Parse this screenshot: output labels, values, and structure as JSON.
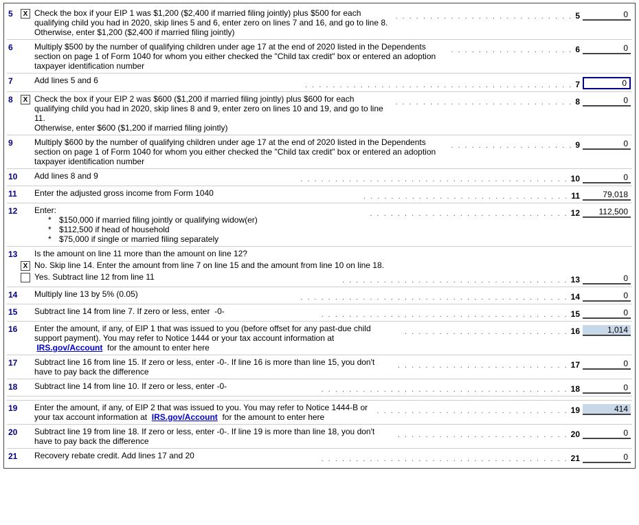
{
  "form": {
    "rows": [
      {
        "id": "row5",
        "lineNum": "5",
        "hasCheckbox": true,
        "checkboxChecked": true,
        "content": "Check the box if your EIP 1 was $1,200 ($2,400 if married filing jointly) plus $500 for each qualifying child you had in 2020, skip lines 5 and 6, enter zero on lines 7 and 16, and go to line 8. Otherwise, enter $1,200 ($2,400 if married filing jointly)",
        "hasDots": true,
        "lineRef": "5",
        "value": "0",
        "highlighted": false,
        "activeBorder": false
      },
      {
        "id": "row6",
        "lineNum": "6",
        "hasCheckbox": false,
        "content": "Multiply $500 by the number of qualifying children under age 17 at the end of 2020 listed in the Dependents section on page 1 of Form 1040 for whom you either checked the \"Child tax credit\" box or entered an adoption taxpayer identification number",
        "hasDots": true,
        "lineRef": "6",
        "value": "0",
        "highlighted": false,
        "activeBorder": false
      },
      {
        "id": "row7",
        "lineNum": "7",
        "hasCheckbox": false,
        "content": "Add lines 5 and 6",
        "hasDots": true,
        "lineRef": "7",
        "value": "0",
        "highlighted": false,
        "activeBorder": true
      },
      {
        "id": "row8",
        "lineNum": "8",
        "hasCheckbox": true,
        "checkboxChecked": true,
        "content": "Check the box if your EIP 2 was $600 ($1,200 if married filing jointly) plus $600 for each qualifying child you had in 2020, skip lines 8 and 9, enter zero on lines 10 and 19, and go to line 11. Otherwise, enter $600 ($1,200 if married filing jointly)",
        "hasDots": true,
        "lineRef": "8",
        "value": "0",
        "highlighted": false,
        "activeBorder": false
      },
      {
        "id": "row9",
        "lineNum": "9",
        "hasCheckbox": false,
        "content": "Multiply $600 by the number of qualifying children under age 17 at the end of 2020 listed in the Dependents section on page 1 of Form 1040 for whom you either checked the \"Child tax credit\" box or entered an adoption taxpayer identification number",
        "hasDots": true,
        "lineRef": "9",
        "value": "0",
        "highlighted": false,
        "activeBorder": false
      },
      {
        "id": "row10",
        "lineNum": "10",
        "hasCheckbox": false,
        "content": "Add lines 8 and 9",
        "hasDots": true,
        "lineRef": "10",
        "value": "0",
        "highlighted": false,
        "activeBorder": false
      },
      {
        "id": "row11",
        "lineNum": "11",
        "hasCheckbox": false,
        "content": "Enter the adjusted gross income from Form 1040",
        "hasDots": true,
        "lineRef": "11",
        "value": "79,018",
        "highlighted": false,
        "activeBorder": false
      },
      {
        "id": "row12",
        "lineNum": "12",
        "hasCheckbox": false,
        "content": "Enter:",
        "bullets": [
          "$150,000 if married filing jointly or qualifying widow(er)",
          "$112,500 if head of household",
          "$75,000 if single or married filing separately"
        ],
        "hasDots": true,
        "lineRef": "12",
        "value": "112,500",
        "highlighted": false,
        "activeBorder": false
      },
      {
        "id": "row13label",
        "lineNum": "13",
        "hasCheckbox": false,
        "content": "Is the amount on line 11 more than the amount on line 12?",
        "hasDots": false,
        "lineRef": "",
        "value": "",
        "highlighted": false,
        "activeBorder": false
      },
      {
        "id": "row13a",
        "isSubRow": true,
        "hasCheckbox": true,
        "checkboxChecked": true,
        "subContent": "No. Skip line 14. Enter the amount from line 7 on line 15 and the amount from line 10 on line 18.",
        "hasDots": false,
        "lineRef": "",
        "value": "",
        "highlighted": false,
        "activeBorder": false
      },
      {
        "id": "row13b",
        "isSubRow": true,
        "hasCheckbox": true,
        "checkboxChecked": false,
        "subContent": "Yes. Subtract line 12 from line 11",
        "hasDots": true,
        "lineRef": "13",
        "value": "0",
        "highlighted": false,
        "activeBorder": false
      },
      {
        "id": "row14",
        "lineNum": "14",
        "hasCheckbox": false,
        "content": "Multiply line 13 by 5% (0.05)",
        "hasDots": true,
        "lineRef": "14",
        "value": "0",
        "highlighted": false,
        "activeBorder": false
      },
      {
        "id": "row15",
        "lineNum": "15",
        "hasCheckbox": false,
        "content": "Subtract line 14 from line 7. If zero or less, enter  -0-",
        "hasDots": true,
        "lineRef": "15",
        "value": "0",
        "highlighted": false,
        "activeBorder": false
      },
      {
        "id": "row16",
        "lineNum": "16",
        "hasCheckbox": false,
        "content": "Enter the amount, if any, of EIP 1 that was issued to you (before offset for any past-due child support payment). You may refer to Notice 1444 or your tax account information at",
        "linkText": "IRS.gov/Account",
        "contentAfterLink": "for the amount to enter here",
        "hasDots": true,
        "lineRef": "16",
        "value": "1,014",
        "highlighted": true,
        "activeBorder": false
      },
      {
        "id": "row17",
        "lineNum": "17",
        "hasCheckbox": false,
        "content": "Subtract line 16 from line 15. If zero or less, enter -0-. If line 16 is more than line 15, you don't have to pay back the difference",
        "hasDots": true,
        "lineRef": "17",
        "value": "0",
        "highlighted": false,
        "activeBorder": false
      },
      {
        "id": "row18",
        "lineNum": "18",
        "hasCheckbox": false,
        "content": "Subtract line 14 from line 10. If zero or less, enter -0-",
        "hasDots": true,
        "lineRef": "18",
        "value": "0",
        "highlighted": false,
        "activeBorder": false
      },
      {
        "id": "spacer",
        "isSpacer": true
      },
      {
        "id": "row19",
        "lineNum": "19",
        "hasCheckbox": false,
        "content": "Enter the amount, if any, of EIP 2 that was issued to you. You may refer to Notice 1444-B or your tax account information at",
        "linkText": "IRS.gov/Account",
        "contentAfterLink": "for the amount to enter here",
        "hasDots": true,
        "lineRef": "19",
        "value": "414",
        "highlighted": true,
        "activeBorder": false
      },
      {
        "id": "row20",
        "lineNum": "20",
        "hasCheckbox": false,
        "content": "Subtract line 19 from line 18. If zero or less, enter -0-. If line 19 is more than line 18, you don't have to pay back the difference",
        "hasDots": true,
        "lineRef": "20",
        "value": "0",
        "highlighted": false,
        "activeBorder": false
      },
      {
        "id": "row21",
        "lineNum": "21",
        "hasCheckbox": false,
        "content": "Recovery rebate credit. Add lines 17 and 20",
        "hasDots": true,
        "lineRef": "21",
        "value": "0",
        "highlighted": false,
        "activeBorder": false
      }
    ]
  }
}
